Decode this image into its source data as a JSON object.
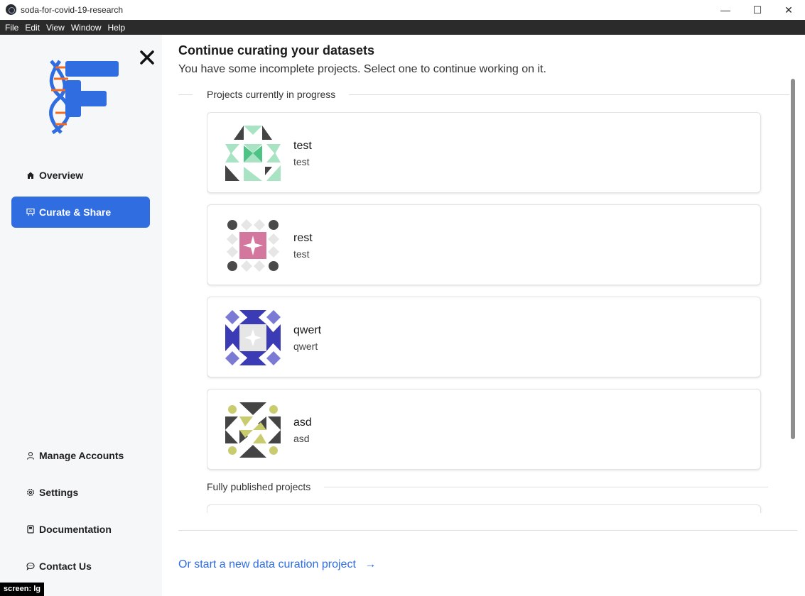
{
  "window": {
    "title": "soda-for-covid-19-research",
    "controls": {
      "minimize": "—",
      "maximize": "☐",
      "close": "✕"
    }
  },
  "menubar": [
    "File",
    "Edit",
    "View",
    "Window",
    "Help"
  ],
  "sidebar": {
    "items_top": [
      {
        "label": "Overview",
        "icon": "home-icon"
      },
      {
        "label": "Curate & Share",
        "icon": "presentation-icon",
        "active": true
      }
    ],
    "items_bottom": [
      {
        "label": "Manage Accounts",
        "icon": "user-icon"
      },
      {
        "label": "Settings",
        "icon": "gear-icon"
      },
      {
        "label": "Documentation",
        "icon": "book-icon"
      },
      {
        "label": "Contact Us",
        "icon": "chat-icon"
      }
    ]
  },
  "screen_badge": "screen: lg",
  "main": {
    "heading": "Continue curating your datasets",
    "subheading": "You have some incomplete projects. Select one to continue working on it.",
    "in_progress_title": "Projects currently in progress",
    "published_title": "Fully published projects",
    "projects": [
      {
        "name": "test",
        "desc": "test",
        "avatar": "avatar-test"
      },
      {
        "name": "rest",
        "desc": "test",
        "avatar": "avatar-rest"
      },
      {
        "name": "qwert",
        "desc": "qwert",
        "avatar": "avatar-qwert"
      },
      {
        "name": "asd",
        "desc": "asd",
        "avatar": "avatar-asd"
      }
    ],
    "new_project_link": "Or start a new data curation project",
    "new_project_arrow": "→"
  },
  "colors": {
    "accent": "#2f6de1",
    "menubar_bg": "#2b2b2b",
    "sidebar_bg": "#f6f7f9",
    "logo_orange": "#f26b21"
  }
}
